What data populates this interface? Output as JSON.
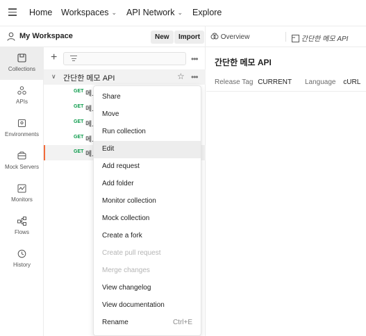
{
  "topbar": {
    "nav": [
      {
        "label": "Home",
        "has_dropdown": false
      },
      {
        "label": "Workspaces",
        "has_dropdown": true
      },
      {
        "label": "API Network",
        "has_dropdown": true
      },
      {
        "label": "Explore",
        "has_dropdown": false
      }
    ],
    "dropdown_glyph": "⌄"
  },
  "workspace": {
    "title": "My Workspace",
    "new_label": "New",
    "import_label": "Import"
  },
  "tabs": [
    {
      "label": "Overview",
      "icon": "overview-icon"
    },
    {
      "label": "간단한 메모 API",
      "icon": "document-icon"
    }
  ],
  "rail": [
    {
      "label": "Collections",
      "icon": "collections-icon",
      "active": true
    },
    {
      "label": "APIs",
      "icon": "apis-icon",
      "active": false
    },
    {
      "label": "Environments",
      "icon": "environments-icon",
      "active": false
    },
    {
      "label": "Mock Servers",
      "icon": "mock-servers-icon",
      "active": false
    },
    {
      "label": "Monitors",
      "icon": "monitors-icon",
      "active": false
    },
    {
      "label": "Flows",
      "icon": "flows-icon",
      "active": false
    },
    {
      "label": "History",
      "icon": "history-icon",
      "active": false
    }
  ],
  "sidebar": {
    "more_glyph": "•••",
    "collection": {
      "name": "간단한 메모 API"
    },
    "requests": [
      {
        "method": "GET",
        "name": "메..",
        "selected": false
      },
      {
        "method": "GET",
        "name": "메..",
        "selected": false
      },
      {
        "method": "GET",
        "name": "메..",
        "selected": false
      },
      {
        "method": "GET",
        "name": "메..",
        "selected": false
      },
      {
        "method": "GET",
        "name": "메..",
        "selected": true
      }
    ]
  },
  "main": {
    "title": "간단한 메모 API",
    "release_tag_label": "Release Tag",
    "release_tag_value": "CURRENT",
    "language_label": "Language",
    "language_value": "cURL"
  },
  "context_menu": {
    "items": [
      {
        "label": "Share",
        "shortcut": "",
        "disabled": false,
        "hover": false
      },
      {
        "label": "Move",
        "shortcut": "",
        "disabled": false,
        "hover": false
      },
      {
        "label": "Run collection",
        "shortcut": "",
        "disabled": false,
        "hover": false
      },
      {
        "label": "Edit",
        "shortcut": "",
        "disabled": false,
        "hover": true
      },
      {
        "label": "Add request",
        "shortcut": "",
        "disabled": false,
        "hover": false
      },
      {
        "label": "Add folder",
        "shortcut": "",
        "disabled": false,
        "hover": false
      },
      {
        "label": "Monitor collection",
        "shortcut": "",
        "disabled": false,
        "hover": false
      },
      {
        "label": "Mock collection",
        "shortcut": "",
        "disabled": false,
        "hover": false
      },
      {
        "label": "Create a fork",
        "shortcut": "",
        "disabled": false,
        "hover": false
      },
      {
        "label": "Create pull request",
        "shortcut": "",
        "disabled": true,
        "hover": false
      },
      {
        "label": "Merge changes",
        "shortcut": "",
        "disabled": true,
        "hover": false
      },
      {
        "label": "View changelog",
        "shortcut": "",
        "disabled": false,
        "hover": false
      },
      {
        "label": "View documentation",
        "shortcut": "",
        "disabled": false,
        "hover": false
      },
      {
        "label": "Rename",
        "shortcut": "Ctrl+E",
        "disabled": false,
        "hover": false
      }
    ]
  },
  "colors": {
    "accent": "#f26b3a",
    "get_method": "#0a9b4a",
    "hover_bg": "#ededed"
  }
}
